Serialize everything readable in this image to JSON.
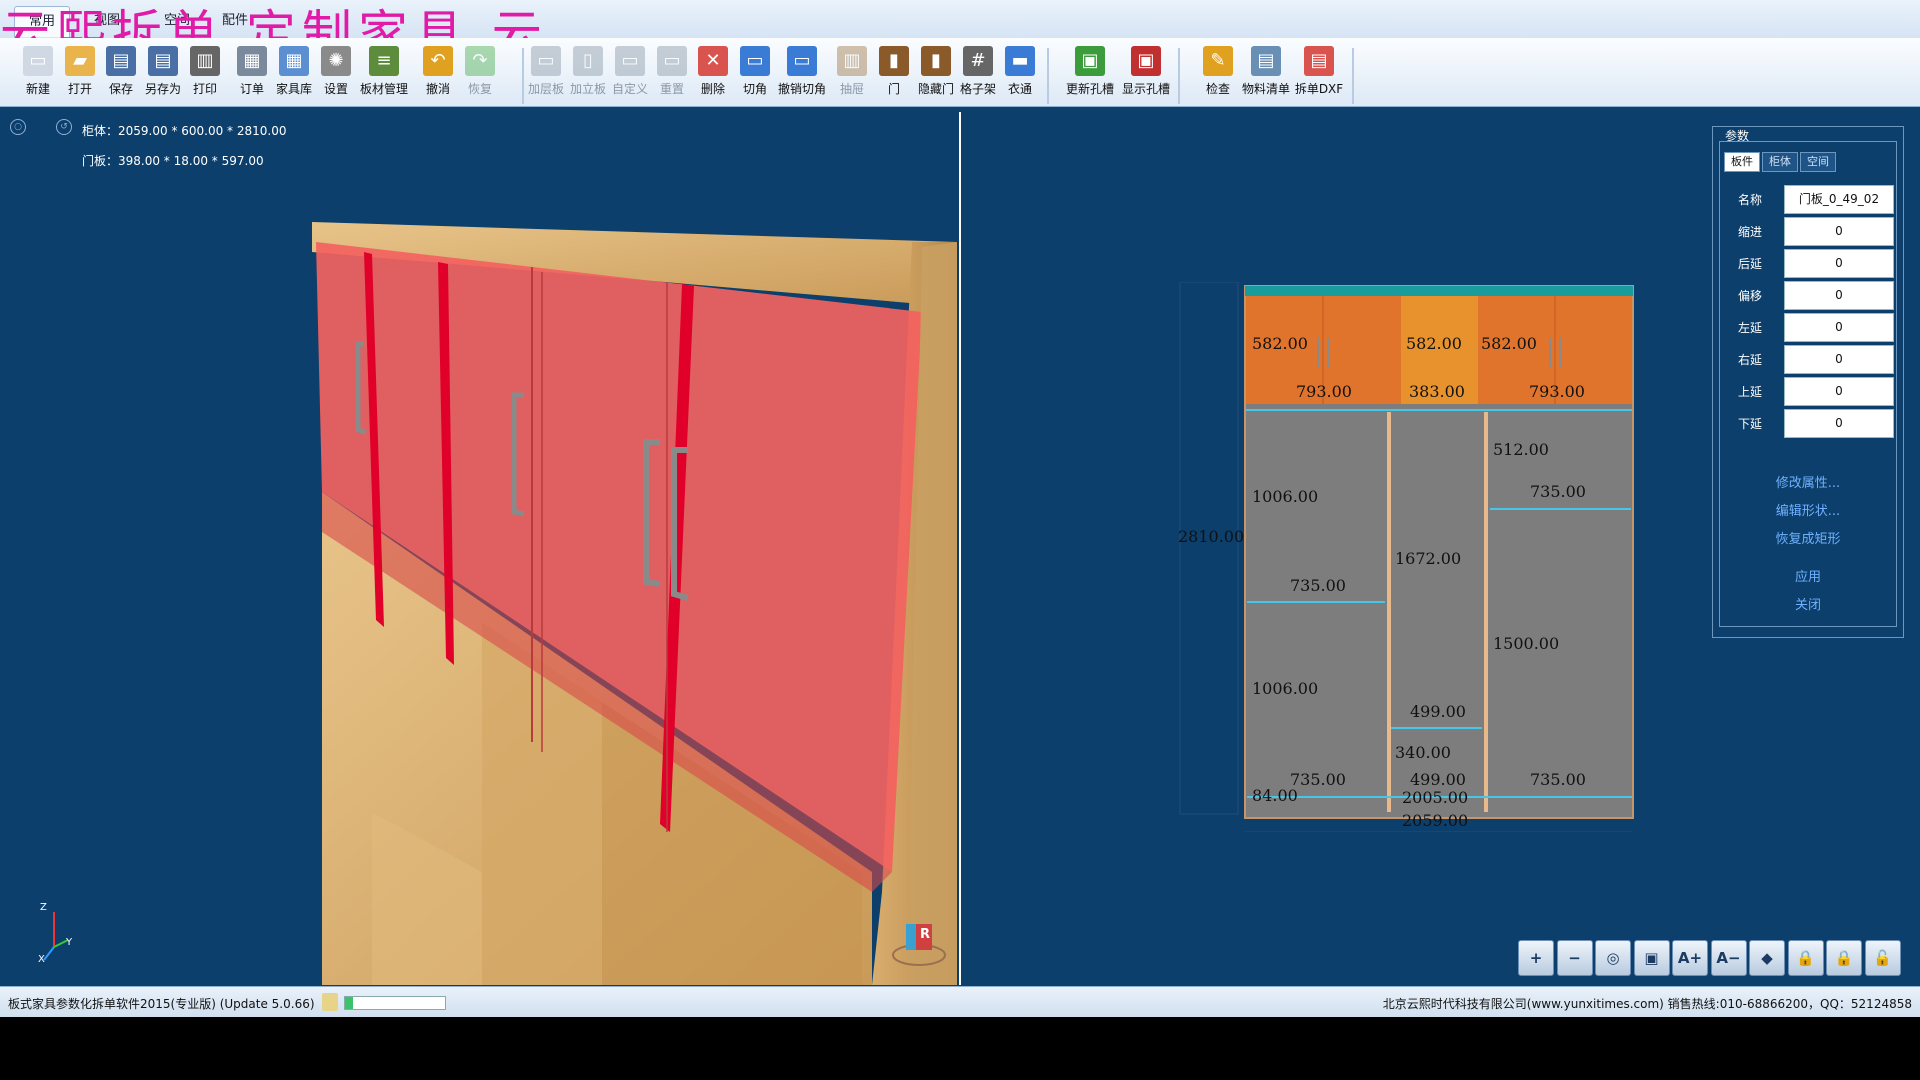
{
  "ribbon": {
    "tabs": [
      "常用",
      "视图",
      "空间",
      "配件"
    ],
    "watermark": "云熙拆单  定制家具  云"
  },
  "toolbar": {
    "buttons": [
      {
        "label": "新建",
        "icon": "new-file-icon",
        "color": "#cfd8e3",
        "enabled": true
      },
      {
        "label": "打开",
        "icon": "open-folder-icon",
        "color": "#e9b44c",
        "enabled": true
      },
      {
        "label": "保存",
        "icon": "save-icon",
        "color": "#4a6fa5",
        "enabled": true
      },
      {
        "label": "另存为",
        "icon": "save-as-icon",
        "color": "#4a6fa5",
        "enabled": true
      },
      {
        "label": "打印",
        "icon": "print-icon",
        "color": "#666",
        "enabled": true
      },
      {
        "label": "订单",
        "icon": "order-icon",
        "color": "#7a8a9c",
        "enabled": true
      },
      {
        "label": "家具库",
        "icon": "library-icon",
        "color": "#5b8fd1",
        "enabled": true
      },
      {
        "label": "设置",
        "icon": "gear-icon",
        "color": "#8a8a8a",
        "enabled": true
      },
      {
        "label": "板材管理",
        "icon": "board-stack-icon",
        "color": "#5c8c3c",
        "enabled": true
      },
      {
        "label": "撤消",
        "icon": "undo-icon",
        "color": "#e0a020",
        "enabled": true
      },
      {
        "label": "恢复",
        "icon": "redo-icon",
        "color": "#4caf50",
        "enabled": false
      },
      {
        "label": "加层板",
        "icon": "add-shelf-icon",
        "color": "#8a9aa8",
        "enabled": false
      },
      {
        "label": "加立板",
        "icon": "add-vertical-icon",
        "color": "#8a9aa8",
        "enabled": false
      },
      {
        "label": "自定义",
        "icon": "custom-icon",
        "color": "#8a9aa8",
        "enabled": false
      },
      {
        "label": "重置",
        "icon": "reset-icon",
        "color": "#8a9aa8",
        "enabled": false
      },
      {
        "label": "删除",
        "icon": "delete-icon",
        "color": "#d9534f",
        "enabled": true
      },
      {
        "label": "切角",
        "icon": "cut-corner-icon",
        "color": "#3a7bd5",
        "enabled": true
      },
      {
        "label": "撤销切角",
        "icon": "undo-cut-corner-icon",
        "color": "#3a7bd5",
        "enabled": true
      },
      {
        "label": "抽屉",
        "icon": "drawer-icon",
        "color": "#a07a4a",
        "enabled": false
      },
      {
        "label": "门",
        "icon": "door-icon",
        "color": "#8b5a2b",
        "enabled": true
      },
      {
        "label": "隐藏门",
        "icon": "hide-door-icon",
        "color": "#8b5a2b",
        "enabled": true
      },
      {
        "label": "格子架",
        "icon": "grid-rack-icon",
        "color": "#666",
        "enabled": true
      },
      {
        "label": "衣通",
        "icon": "hanger-rod-icon",
        "color": "#3a7bd5",
        "enabled": true
      },
      {
        "label": "更新孔槽",
        "icon": "update-holes-icon",
        "color": "#3c9c3c",
        "enabled": true
      },
      {
        "label": "显示孔槽",
        "icon": "show-holes-icon",
        "color": "#c03030",
        "enabled": true
      },
      {
        "label": "检查",
        "icon": "check-icon",
        "color": "#e0a020",
        "enabled": true
      },
      {
        "label": "物料清单",
        "icon": "material-list-icon",
        "color": "#6a8fb5",
        "enabled": true
      },
      {
        "label": "拆单DXF",
        "icon": "dxf-export-icon",
        "color": "#d9534f",
        "enabled": true
      }
    ]
  },
  "left_tools": [
    "add-piece-icon",
    "remove-piece-icon",
    "rotate-icon",
    "zoom-icon",
    "contrast-icon",
    "camera-icon",
    "fit-view-icon",
    "binocular-icon",
    "wireframe-icon",
    "material-icon",
    "add-board-icon",
    "refresh-board-icon",
    "search-board-icon",
    "copy-icon",
    "dxf-icon",
    "export-icon"
  ],
  "viewport": {
    "cabinet_info": "柜体：2059.00 * 600.00 * 2810.00",
    "door_info": "门板：398.00 * 18.00 * 597.00",
    "axis_z": "Z",
    "axis_y": "Y",
    "axis_x": "X",
    "cube_letter": "R"
  },
  "drawing": {
    "labels": {
      "height_total": "2810.00",
      "top_l_h": "582.00",
      "top_m_h": "582.00",
      "top_r_h": "582.00",
      "top_l_w": "793.00",
      "top_m_w": "383.00",
      "top_r_w": "793.00",
      "left_up_h": "1006.00",
      "left_up_w": "735.00",
      "left_lo_h": "1006.00",
      "left_lo_w": "735.00",
      "mid_h": "1672.00",
      "mid_w1": "499.00",
      "mid_h2": "340.00",
      "mid_w2": "499.00",
      "right_top_h": "512.00",
      "right_top_w": "735.00",
      "right_lo_h": "1500.00",
      "right_lo_w": "735.00",
      "bottom_h": "84.00",
      "inner_w": "2005.00",
      "outer_w": "2059.00"
    }
  },
  "params_panel": {
    "title": "参数",
    "tabs": [
      "板件",
      "柜体",
      "空间"
    ],
    "fields": [
      {
        "label": "名称",
        "value": "门板_0_49_02"
      },
      {
        "label": "缩进",
        "value": "0"
      },
      {
        "label": "后延",
        "value": "0"
      },
      {
        "label": "偏移",
        "value": "0"
      },
      {
        "label": "左延",
        "value": "0"
      },
      {
        "label": "右延",
        "value": "0"
      },
      {
        "label": "上延",
        "value": "0"
      },
      {
        "label": "下延",
        "value": "0"
      }
    ],
    "links": [
      "修改属性...",
      "编辑形状...",
      "恢复成矩形",
      "应用",
      "关闭"
    ]
  },
  "zoom_buttons": [
    {
      "icon": "zoom-in-icon",
      "glyph": "+"
    },
    {
      "icon": "zoom-out-icon",
      "glyph": "−"
    },
    {
      "icon": "zoom-fit-icon",
      "glyph": "◎"
    },
    {
      "icon": "screenshot-icon",
      "glyph": "▣"
    },
    {
      "icon": "font-larger-icon",
      "glyph": "A+"
    },
    {
      "icon": "font-smaller-icon",
      "glyph": "A−"
    },
    {
      "icon": "tag-icon",
      "glyph": "◆"
    },
    {
      "icon": "lock-icon",
      "glyph": "🔒"
    },
    {
      "icon": "lock-alt-icon",
      "glyph": "🔒"
    },
    {
      "icon": "unlock-icon",
      "glyph": "🔓"
    }
  ],
  "statusbar": {
    "app_name": "板式家具参数化拆单软件2015(专业版) (Update 5.0.66)",
    "company": "北京云熙时代科技有限公司(www.yunxitimes.com)  销售热线:010-68866200，QQ：52124858",
    "progress_percent": 8
  }
}
